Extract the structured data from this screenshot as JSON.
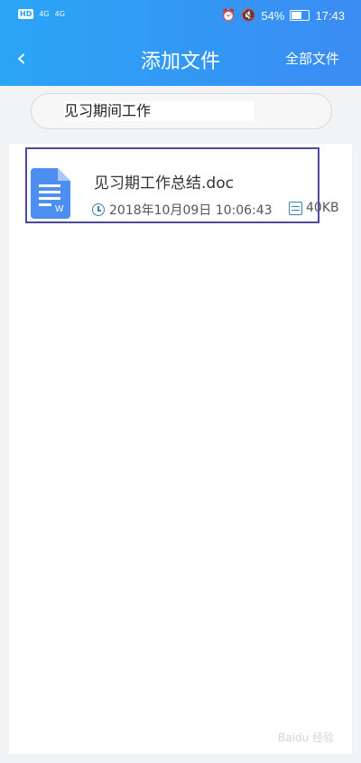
{
  "status": {
    "signal_left_1": "4G",
    "signal_left_2": "4G",
    "hd_label": "HD",
    "battery_percent": "54%",
    "time": "17:43"
  },
  "header": {
    "back_icon": "chevron-left-icon",
    "title": "添加文件",
    "right_action": "全部文件"
  },
  "search": {
    "query": "见习期间工作"
  },
  "file": {
    "name": "见习期工作总结.doc",
    "datetime": "2018年10月09日 10:06:43",
    "size": "40KB",
    "icon": "word-document-icon"
  },
  "colors": {
    "header_start": "#2aa5f6",
    "header_end": "#3b8cf3",
    "highlight_border": "#4a4aa0"
  },
  "watermark": "Baidu 经验"
}
